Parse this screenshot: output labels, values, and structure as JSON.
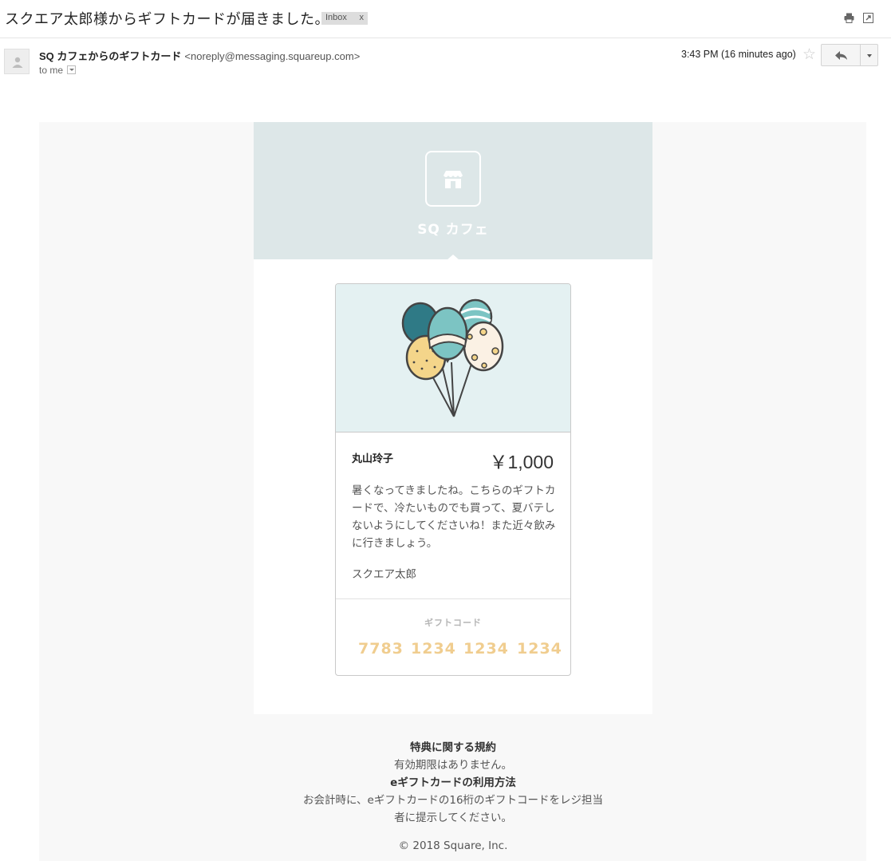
{
  "header": {
    "subject": "スクエア太郎様からギフトカードが届きました。",
    "label_chip": "Inbox",
    "label_remove": "x"
  },
  "message_meta": {
    "sender_name": "SQ カフェからのギフトカード",
    "sender_email": "<noreply@messaging.squareup.com>",
    "to": "to me",
    "timestamp": "3:43 PM (16 minutes ago)",
    "star_glyph": "☆"
  },
  "icons": {
    "print": "printer-icon",
    "popout": "popout-icon",
    "reply": "reply-icon",
    "more": "chevron-down-icon",
    "avatar": "person-icon",
    "store": "storefront-icon"
  },
  "colors": {
    "banner": "#dde7e8",
    "card_art_bg": "#e4f1f2",
    "gift_code": "#f0cd8f",
    "teal_dark": "#2f7a86",
    "teal_light": "#7cc4c3",
    "yellow": "#f4d58a"
  },
  "email": {
    "store_name": "SQ カフェ",
    "card": {
      "recipient": "丸山玲子",
      "amount": "￥1,000",
      "message": "暑くなってきましたね。こちらのギフトカードで、冷たいものでも買って、夏バテしないようにしてくださいね！また近々飲みに行きましょう。",
      "signature": "スクエア太郎",
      "code_label": "ギフトコード",
      "code_segments": [
        "7783",
        "1234",
        "1234",
        "1234"
      ]
    },
    "footer": {
      "terms_heading": "特典に関する規約",
      "terms_text": "有効期限はありません。",
      "usage_heading": "eギフトカードの利用方法",
      "usage_text_1": "お会計時に、eギフトカードの16桁のギフトコードをレジ担当",
      "usage_text_2": "者に提示してください。",
      "copyright": "© 2018 Square, Inc."
    }
  }
}
